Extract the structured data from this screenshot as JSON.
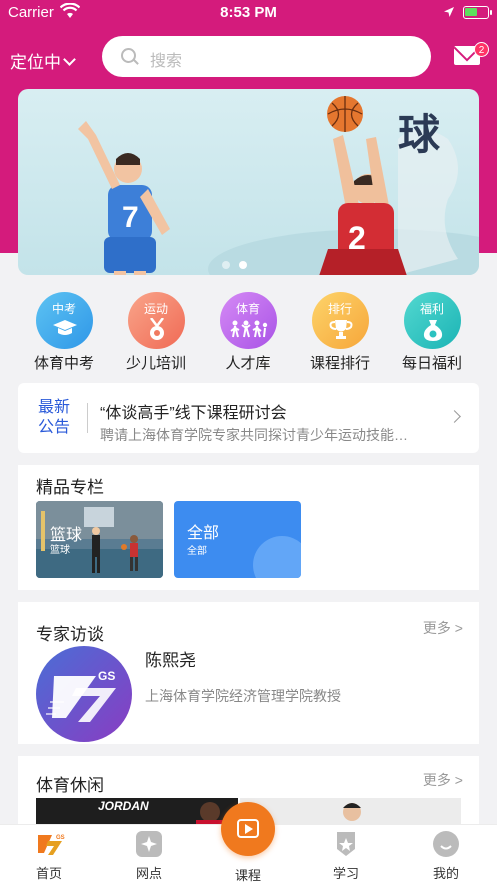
{
  "status_bar": {
    "carrier": "Carrier",
    "time": "8:53 PM"
  },
  "header": {
    "location_label": "定位中",
    "search_placeholder": "搜索",
    "mail_badge": "2"
  },
  "banner": {
    "slides": 2,
    "active_slide": 2,
    "text": "球"
  },
  "categories": [
    {
      "tag": "中考",
      "label": "体育中考",
      "color_from": "#5dc3f2",
      "color_to": "#2f97e8"
    },
    {
      "tag": "运动",
      "label": "少儿培训",
      "color_from": "#f9a58a",
      "color_to": "#f06a55"
    },
    {
      "tag": "体育",
      "label": "人才库",
      "color_from": "#d58af5",
      "color_to": "#a953e6"
    },
    {
      "tag": "排行",
      "label": "课程排行",
      "color_from": "#fdd46a",
      "color_to": "#f6a63a"
    },
    {
      "tag": "福利",
      "label": "每日福利",
      "color_from": "#53d8d0",
      "color_to": "#1bb4b5"
    }
  ],
  "notice": {
    "tag_line1": "最新",
    "tag_line2": "公告",
    "title": "“体谈高手”线下课程研讨会",
    "subtitle": "聘请上海体育学院专家共同探讨青少年运动技能…"
  },
  "featured": {
    "title": "精品专栏",
    "card1_title": "篮球",
    "card1_sub": "篮球",
    "card2_title": "全部",
    "card2_sub": "全部"
  },
  "experts": {
    "title": "专家访谈",
    "more": "更多 >",
    "name": "陈熙尧",
    "desc": "上海体育学院经济管理学院教授",
    "logo_text": "GS"
  },
  "leisure": {
    "title": "体育休闲",
    "more": "更多 >",
    "image_text": "JORDAN"
  },
  "tabbar": {
    "home": "首页",
    "spots": "网点",
    "courses": "课程",
    "study": "学习",
    "mine": "我的"
  },
  "colors": {
    "brand": "#d41b7c",
    "accent_orange": "#f0791e",
    "notice_blue": "#2a5ad9"
  }
}
